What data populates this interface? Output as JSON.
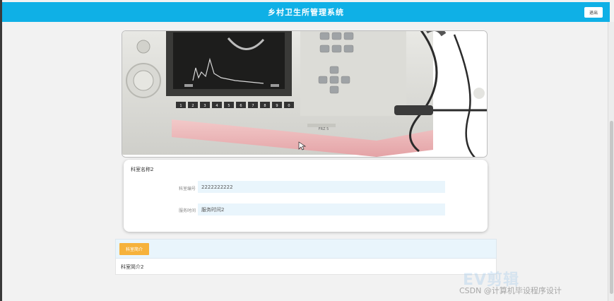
{
  "header": {
    "title": "乡村卫生所管理系统",
    "logout_label": "退出"
  },
  "device_image": {
    "icon": "ultrasound-device-photo",
    "screen_label": "FRZ 5",
    "keypad": [
      "1",
      "2",
      "3",
      "4",
      "5",
      "6",
      "7",
      "8",
      "9",
      "0"
    ]
  },
  "detail": {
    "name": "科室名称2",
    "fields": [
      {
        "label": "科室编号",
        "value": "2222222222"
      },
      {
        "label": "服务时间",
        "value": "服务时间2"
      }
    ]
  },
  "tabs": {
    "active_label": "科室简介",
    "content": "科室简介2"
  },
  "watermark": {
    "logo": "EV剪辑",
    "text": "CSDN @计算机毕设程序设计"
  },
  "colors": {
    "header": "#0fb0e6",
    "tab_button": "#f6b23c",
    "field_bg": "#e9f5fc"
  }
}
